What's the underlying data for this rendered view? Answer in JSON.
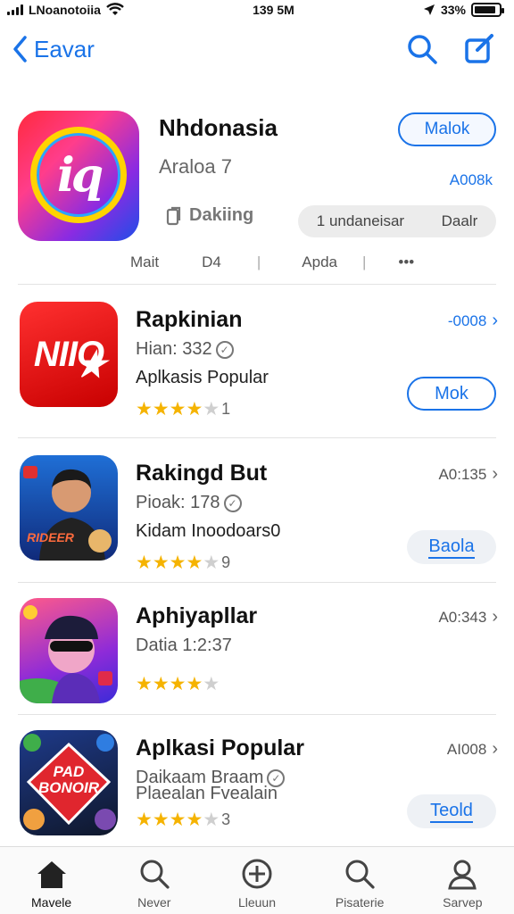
{
  "status": {
    "carrier": "LNoanotoiia",
    "time": "139 5M",
    "battery": "33%"
  },
  "nav": {
    "back_label": "Eavar"
  },
  "featured": {
    "title": "Nhdonasia",
    "subtitle": "Araloa 7",
    "rank_label": "Dakiing",
    "button_label": "Malok",
    "price": "A008k",
    "pill_left": "1 undaneisar",
    "pill_right": "Daalr",
    "meta": [
      "Mait",
      "D4",
      "Apda",
      "•••"
    ]
  },
  "apps": [
    {
      "title": "Rapkinian",
      "line1": "Hian: 332",
      "line2": "Aplkasis Popular",
      "stars": 4,
      "count": "1",
      "price": "-0008",
      "button_label": "Mok",
      "icon_text": "NIIO"
    },
    {
      "title": "Rakingd But",
      "line1": "Pioak: 178",
      "line2": "Kidam Inoodoars0",
      "stars": 4,
      "count": "9",
      "price": "A0:135",
      "button_label": "Baola",
      "icon_text": "RIDEER"
    },
    {
      "title": "Aphiyapllar",
      "line1": "Datia 1:2:37",
      "line2": "",
      "stars": 4,
      "count": "",
      "price": "A0:343",
      "button_label": ""
    },
    {
      "title": "Aplkasi Popular",
      "line1": "Daikaam Braam",
      "line2": "Plaealan Fvealain",
      "stars": 4,
      "count": "3",
      "price": "AI008",
      "button_label": "Teold",
      "icon_text": "PAD BONOIR"
    }
  ],
  "tabs": [
    {
      "label": "Mavele"
    },
    {
      "label": "Never"
    },
    {
      "label": "Lleuun"
    },
    {
      "label": "Pisaterie"
    },
    {
      "label": "Sarvep"
    }
  ],
  "colors": {
    "accent": "#1a73e8",
    "star": "#f5b300"
  }
}
